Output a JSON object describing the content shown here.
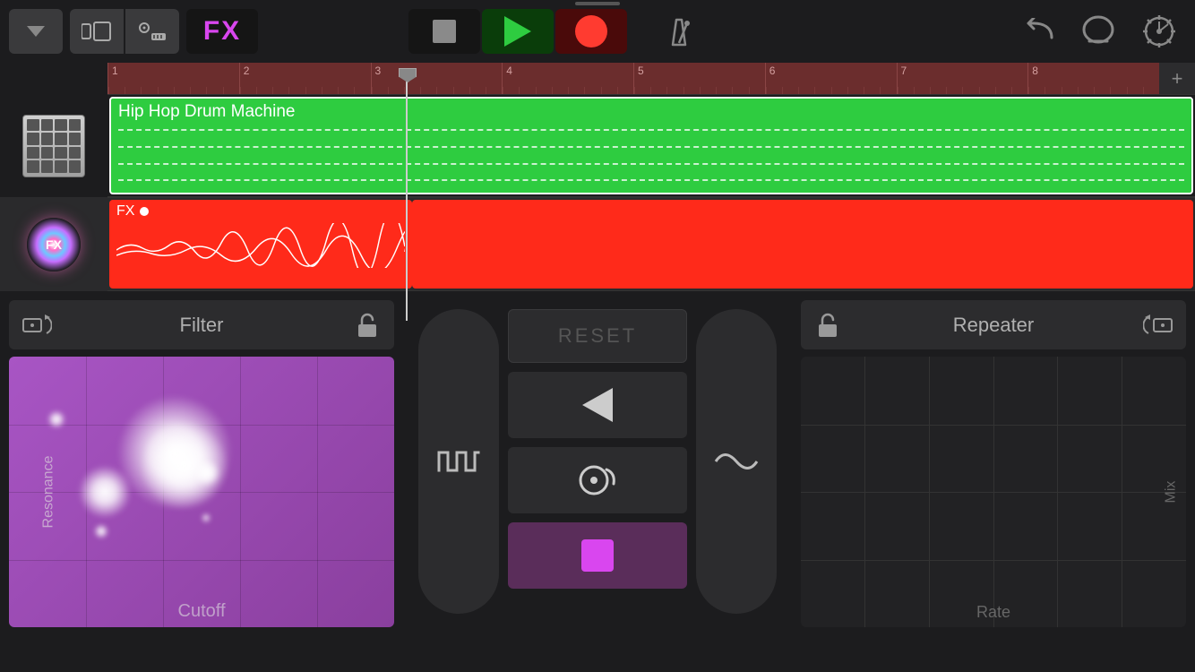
{
  "toolbar": {
    "fx_label": "FX"
  },
  "ruler": {
    "bars": [
      "1",
      "2",
      "3",
      "4",
      "5",
      "6",
      "7",
      "8"
    ]
  },
  "tracks": [
    {
      "name": "Hip Hop Drum Machine",
      "color": "#2ecc40"
    },
    {
      "name": "FX",
      "color": "#ff2a1a"
    }
  ],
  "fx_panel": {
    "left": {
      "title": "Filter",
      "x_axis": "Cutoff",
      "y_axis": "Resonance"
    },
    "right": {
      "title": "Repeater",
      "x_axis": "Rate",
      "y_axis": "Mix"
    },
    "reset_label": "RESET"
  }
}
